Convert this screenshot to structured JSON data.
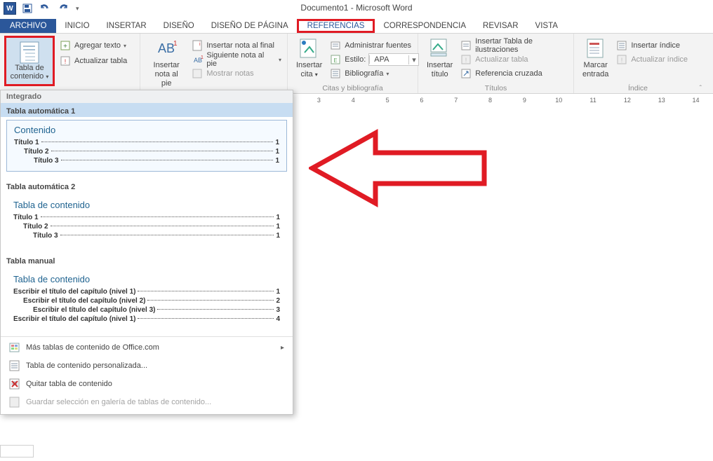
{
  "qat": {
    "save_alt": "Guardar",
    "undo_alt": "Deshacer",
    "redo_alt": "Rehacer"
  },
  "title": "Documento1 - Microsoft Word",
  "tabs": {
    "archivo": "ARCHIVO",
    "inicio": "INICIO",
    "insertar": "INSERTAR",
    "diseno": "DISEÑO",
    "diseno_pagina": "DISEÑO DE PÁGINA",
    "referencias": "REFERENCIAS",
    "correspondencia": "CORRESPONDENCIA",
    "revisar": "REVISAR",
    "vista": "VISTA"
  },
  "ribbon": {
    "toc": {
      "line1": "Tabla de",
      "line2": "contenido"
    },
    "toc_side": {
      "add_text": "Agregar texto",
      "update_table": "Actualizar tabla"
    },
    "footnote": {
      "big_line1": "Insertar",
      "big_line2": "nota al pie",
      "end_note": "Insertar nota al final",
      "next_note": "Siguiente nota al pie",
      "show_notes": "Mostrar notas"
    },
    "citations": {
      "big_line1": "Insertar",
      "big_line2": "cita",
      "manage": "Administrar fuentes",
      "style_label": "Estilo:",
      "style_value": "APA",
      "biblio": "Bibliografía",
      "group": "Citas y bibliografía"
    },
    "captions": {
      "big_line1": "Insertar",
      "big_line2": "título",
      "table_fig": "Insertar Tabla de ilustraciones",
      "update": "Actualizar tabla",
      "crossref": "Referencia cruzada",
      "group": "Títulos"
    },
    "index": {
      "big_line1": "Marcar",
      "big_line2": "entrada",
      "insert": "Insertar índice",
      "update": "Actualizar índice",
      "group": "Índice"
    }
  },
  "ruler": [
    "3",
    "4",
    "5",
    "6",
    "7",
    "8",
    "9",
    "10",
    "11",
    "12",
    "13",
    "14"
  ],
  "gallery": {
    "header": "Integrado",
    "s1": {
      "name": "Tabla automática 1",
      "title": "Contenido",
      "rows": [
        {
          "level": 1,
          "text": "Título 1",
          "page": "1"
        },
        {
          "level": 2,
          "text": "Título 2",
          "page": "1"
        },
        {
          "level": 3,
          "text": "Título 3",
          "page": "1"
        }
      ]
    },
    "s2": {
      "name": "Tabla automática 2",
      "title": "Tabla de contenido",
      "rows": [
        {
          "level": 1,
          "text": "Título 1",
          "page": "1"
        },
        {
          "level": 2,
          "text": "Título 2",
          "page": "1"
        },
        {
          "level": 3,
          "text": "Título 3",
          "page": "1"
        }
      ]
    },
    "s3": {
      "name": "Tabla manual",
      "title": "Tabla de contenido",
      "rows": [
        {
          "level": 1,
          "text": "Escribir el título del capítulo (nivel 1)",
          "page": "1"
        },
        {
          "level": 2,
          "text": "Escribir el título del capítulo (nivel 2)",
          "page": "2"
        },
        {
          "level": 3,
          "text": "Escribir el título del capítulo (nivel 3)",
          "page": "3"
        },
        {
          "level": 1,
          "text": "Escribir el título del capítulo (nivel 1)",
          "page": "4"
        }
      ]
    },
    "menu": {
      "more": "Más tablas de contenido de Office.com",
      "custom": "Tabla de contenido personalizada...",
      "remove": "Quitar tabla de contenido",
      "save": "Guardar selección en galería de tablas de contenido..."
    }
  }
}
